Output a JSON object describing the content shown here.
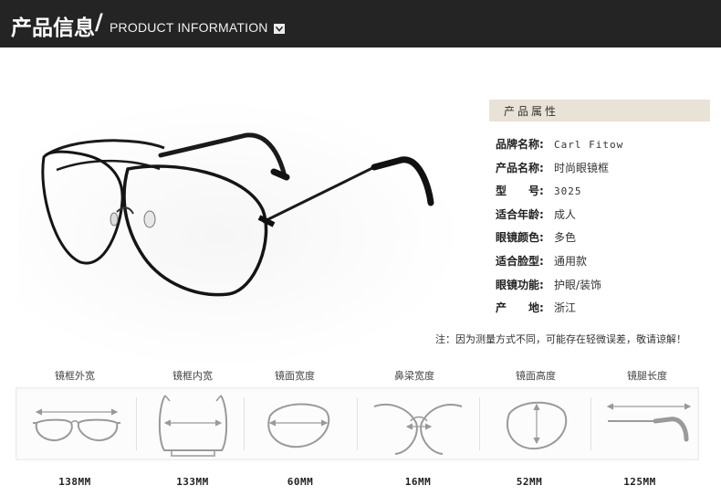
{
  "header": {
    "title_cn": "产品信息",
    "slash": "/",
    "title_en": "PRODUCT INFORMATION",
    "chevron_icon": "chevron-down-icon",
    "background": "#242424"
  },
  "attributes": {
    "heading": "产品属性",
    "heading_bg": "#e8e3d6",
    "rows": [
      {
        "key": "品牌名称:",
        "value": "Carl Fitow"
      },
      {
        "key": "产品名称:",
        "value": "时尚眼镜框"
      },
      {
        "key": "型　　号:",
        "value": "3025"
      },
      {
        "key": "适合年龄:",
        "value": "成人"
      },
      {
        "key": "眼镜颜色:",
        "value": "多色"
      },
      {
        "key": "适合脸型:",
        "value": "通用款"
      },
      {
        "key": "眼镜功能:",
        "value": "护眼/装饰"
      },
      {
        "key": "产　　地:",
        "value": "浙江"
      }
    ]
  },
  "note": "注：因为测量方式不同，可能存在轻微误差，敬请谅解！",
  "measurements": [
    {
      "label": "镜框外宽",
      "value": "138MM",
      "icon": "frame-outer-width-icon"
    },
    {
      "label": "镜框内宽",
      "value": "133MM",
      "icon": "frame-inner-width-icon"
    },
    {
      "label": "镜面宽度",
      "value": "60MM",
      "icon": "lens-width-icon"
    },
    {
      "label": "鼻梁宽度",
      "value": "16MM",
      "icon": "bridge-width-icon"
    },
    {
      "label": "镜面高度",
      "value": "52MM",
      "icon": "lens-height-icon"
    },
    {
      "label": "镜腿长度",
      "value": "125MM",
      "icon": "temple-length-icon"
    }
  ]
}
